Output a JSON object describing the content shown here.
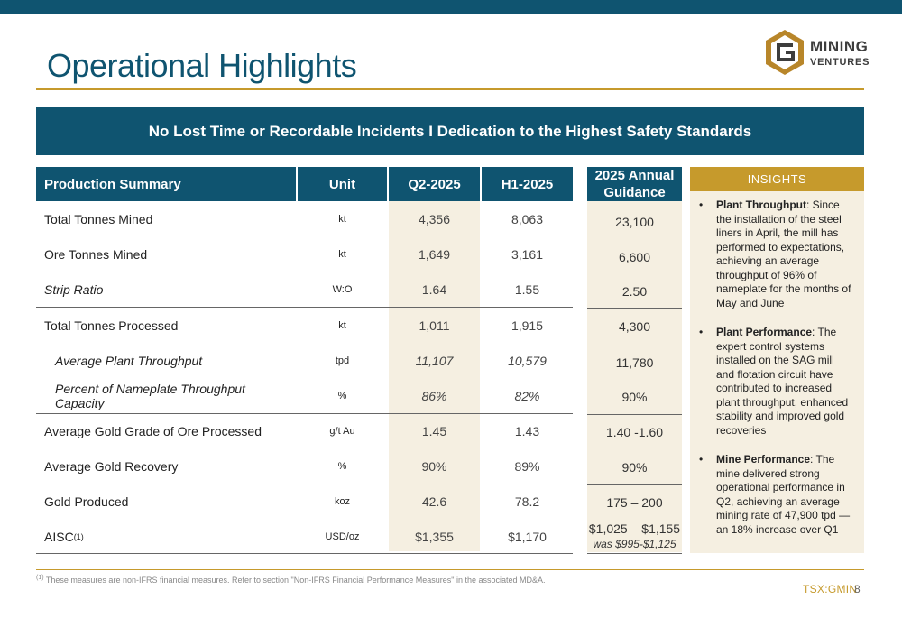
{
  "header": {
    "title": "Operational Highlights",
    "logo": {
      "line1": "MINING",
      "line2": "VENTURES",
      "mark": "G"
    }
  },
  "banner": "No Lost Time or Recordable Incidents I Dedication to the Highest Safety Standards",
  "table": {
    "columns": {
      "label": "Production Summary",
      "unit": "Unit",
      "q2": "Q2-2025",
      "h1": "H1-2025",
      "guidance": "2025 Annual Guidance"
    },
    "rows": [
      {
        "label": "Total Tonnes Mined",
        "unit": "kt",
        "q2": "4,356",
        "h1": "8,063",
        "guidance": "23,100"
      },
      {
        "label": "Ore Tonnes Mined",
        "unit": "kt",
        "q2": "1,649",
        "h1": "3,161",
        "guidance": "6,600"
      },
      {
        "label": "Strip Ratio",
        "unit": "W:O",
        "q2": "1.64",
        "h1": "1.55",
        "guidance": "2.50"
      },
      {
        "label": "Total Tonnes Processed",
        "unit": "kt",
        "q2": "1,011",
        "h1": "1,915",
        "guidance": "4,300"
      },
      {
        "label": "Average Plant Throughput",
        "unit": "tpd",
        "q2": "11,107",
        "h1": "10,579",
        "guidance": "11,780"
      },
      {
        "label": "Percent of Nameplate Throughput Capacity",
        "unit": "%",
        "q2": "86%",
        "h1": "82%",
        "guidance": "90%"
      },
      {
        "label": "Average Gold Grade of Ore Processed",
        "unit": "g/t Au",
        "q2": "1.45",
        "h1": "1.43",
        "guidance": "1.40 -1.60"
      },
      {
        "label": "Average Gold Recovery",
        "unit": "%",
        "q2": "90%",
        "h1": "89%",
        "guidance": "90%"
      },
      {
        "label": "Gold Produced",
        "unit": "koz",
        "q2": "42.6",
        "h1": "78.2",
        "guidance": "175 – 200"
      },
      {
        "label": "AISC",
        "label_sup": "(1)",
        "unit": "USD/oz",
        "q2": "$1,355",
        "h1": "$1,170",
        "guidance": "$1,025 – $1,155",
        "guidance_note": "was $995-$1,125"
      }
    ]
  },
  "insights": {
    "title": "INSIGHTS",
    "items": [
      {
        "title": "Plant Throughput",
        "text": ": Since the installation of the steel liners in April, the mill has performed to expectations, achieving an average throughput of 96% of nameplate for the months of May and June"
      },
      {
        "title": "Plant Performance",
        "text": ": The expert control systems installed on the SAG mill and flotation circuit have contributed to increased plant throughput, enhanced stability and improved gold recoveries"
      },
      {
        "title": "Mine Performance",
        "text": ": The mine delivered strong operational performance in Q2, achieving an average mining rate of 47,900 tpd — an 18% increase over Q1"
      }
    ],
    "bullet": "•"
  },
  "footer": {
    "footnote_sup": "(1)",
    "footnote": "These measures are non-IFRS financial measures. Refer to section \"Non-IFRS Financial Performance Measures\" in the associated MD&A.",
    "ticker": "TSX:GMIN",
    "page": "8"
  },
  "colors": {
    "primary": "#0f5470",
    "accent": "#c69a2c",
    "shade": "#f5efe1"
  }
}
